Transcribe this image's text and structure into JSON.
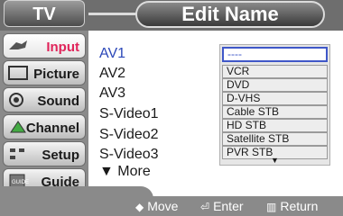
{
  "header": {
    "tv_label": "TV",
    "title": "Edit Name"
  },
  "sidebar": {
    "items": [
      {
        "label": "Input",
        "icon": "input-icon",
        "active": true
      },
      {
        "label": "Picture",
        "icon": "picture-icon",
        "active": false
      },
      {
        "label": "Sound",
        "icon": "sound-icon",
        "active": false
      },
      {
        "label": "Channel",
        "icon": "channel-icon",
        "active": false
      },
      {
        "label": "Setup",
        "icon": "setup-icon",
        "active": false
      },
      {
        "label": "Guide",
        "icon": "guide-icon",
        "active": false
      }
    ]
  },
  "inputs": {
    "items": [
      "AV1",
      "AV2",
      "AV3",
      "S-Video1",
      "S-Video2",
      "S-Video3",
      "▼ More"
    ]
  },
  "dropdown": {
    "selected": "----",
    "options": [
      "VCR",
      "DVD",
      "D-VHS",
      "Cable STB",
      "HD STB",
      "Satellite STB",
      "PVR STB"
    ],
    "more_arrow": "▼"
  },
  "footer": {
    "move": "Move",
    "enter": "Enter",
    "return": "Return"
  },
  "colors": {
    "highlight_text": "#2b47b8",
    "active_sidebar": "#e0245a",
    "dropdown_border": "#3f57c8"
  }
}
